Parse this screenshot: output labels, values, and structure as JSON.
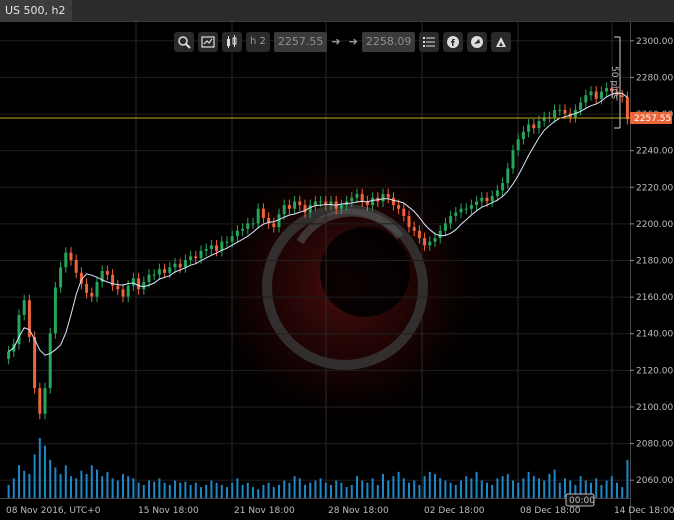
{
  "window": {
    "tab_title": "US 500, h2"
  },
  "toolbar": {
    "timeframe": "h 2",
    "bid": "2257.55",
    "ask": "2258.09",
    "icons": [
      "zoom-icon",
      "chart-settings-icon",
      "candles-icon",
      "list-icon",
      "facebook-icon",
      "share-icon",
      "watch-icon"
    ]
  },
  "ruler_label": "50 pips",
  "time_badge": "00:00",
  "price_tag": "2257.55",
  "colors": {
    "bull": "#26a65b",
    "bear": "#f0643c",
    "line": "#d8e8ff",
    "volume": "#1f86c8",
    "price_line": "#c9a227",
    "tag": "#e8663a"
  },
  "chart_data": {
    "type": "candlestick",
    "y_ticks": [
      "2300.00",
      "2280.00",
      "2260.00",
      "2240.00",
      "2220.00",
      "2200.00",
      "2180.00",
      "2160.00",
      "2140.00",
      "2120.00",
      "2100.00",
      "2080.00",
      "2060.00"
    ],
    "x_ticks": [
      "08 Nov 2016, UTC+0",
      "15 Nov 18:00",
      "21 Nov 18:00",
      "28 Nov 18:00",
      "02 Dec 18:00",
      "08 Dec 18:00",
      "14 Dec 18:00"
    ],
    "ylim": [
      2050,
      2310
    ],
    "current_price": 2257.55,
    "closes": [
      2130,
      2134,
      2150,
      2158,
      2138,
      2110,
      2096,
      2110,
      2140,
      2165,
      2176,
      2184,
      2180,
      2173,
      2167,
      2162,
      2160,
      2168,
      2174,
      2172,
      2166,
      2164,
      2160,
      2166,
      2170,
      2164,
      2168,
      2172,
      2172,
      2175,
      2173,
      2176,
      2178,
      2176,
      2180,
      2182,
      2181,
      2185,
      2186,
      2188,
      2185,
      2190,
      2190,
      2193,
      2196,
      2197,
      2200,
      2200,
      2208,
      2203,
      2200,
      2198,
      2205,
      2210,
      2208,
      2212,
      2210,
      2206,
      2210,
      2212,
      2212,
      2210,
      2212,
      2208,
      2210,
      2212,
      2214,
      2216,
      2212,
      2210,
      2214,
      2212,
      2216,
      2214,
      2210,
      2208,
      2204,
      2198,
      2196,
      2192,
      2188,
      2190,
      2192,
      2196,
      2200,
      2204,
      2206,
      2208,
      2208,
      2210,
      2212,
      2214,
      2212,
      2215,
      2218,
      2222,
      2230,
      2240,
      2246,
      2250,
      2254,
      2252,
      2256,
      2258,
      2258,
      2262,
      2262,
      2260,
      2258,
      2262,
      2266,
      2270,
      2272,
      2268,
      2272,
      2274,
      2272,
      2270,
      2269,
      2257
    ],
    "volumes": [
      12,
      18,
      30,
      25,
      22,
      40,
      55,
      48,
      35,
      28,
      22,
      30,
      20,
      18,
      25,
      22,
      30,
      26,
      20,
      24,
      18,
      16,
      22,
      20,
      18,
      14,
      12,
      16,
      15,
      18,
      14,
      12,
      16,
      14,
      15,
      12,
      14,
      10,
      12,
      16,
      14,
      12,
      10,
      14,
      18,
      12,
      14,
      10,
      8,
      12,
      14,
      10,
      12,
      16,
      14,
      20,
      18,
      12,
      14,
      16,
      18,
      14,
      12,
      16,
      14,
      10,
      12,
      20,
      16,
      14,
      18,
      12,
      22,
      16,
      20,
      24,
      18,
      14,
      16,
      12,
      20,
      24,
      22,
      18,
      16,
      14,
      12,
      16,
      20,
      18,
      24,
      16,
      14,
      12,
      18,
      20,
      22,
      16,
      14,
      18,
      24,
      20,
      18,
      16,
      22,
      26,
      14,
      18,
      16,
      12,
      20,
      16,
      14,
      18,
      12,
      16,
      20,
      14,
      10,
      35
    ]
  }
}
